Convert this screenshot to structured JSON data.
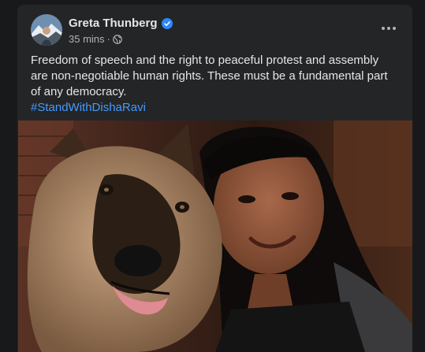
{
  "post": {
    "author": "Greta Thunberg",
    "timestamp": "35 mins",
    "separator": "·",
    "body": "Freedom of speech and the right to peaceful protest and assembly are non-negotiable human rights. These must be a fundamental part of any democracy.",
    "hashtag": "#StandWithDishaRavi"
  },
  "icons": {
    "verified": "verified-badge-icon",
    "audience": "globe-icon",
    "more": "more-options-icon"
  },
  "colors": {
    "background": "#18191a",
    "card": "#242526",
    "text": "#e4e6eb",
    "secondary_text": "#b0b3b8",
    "link": "#4599ff",
    "verified": "#2d88ff"
  }
}
